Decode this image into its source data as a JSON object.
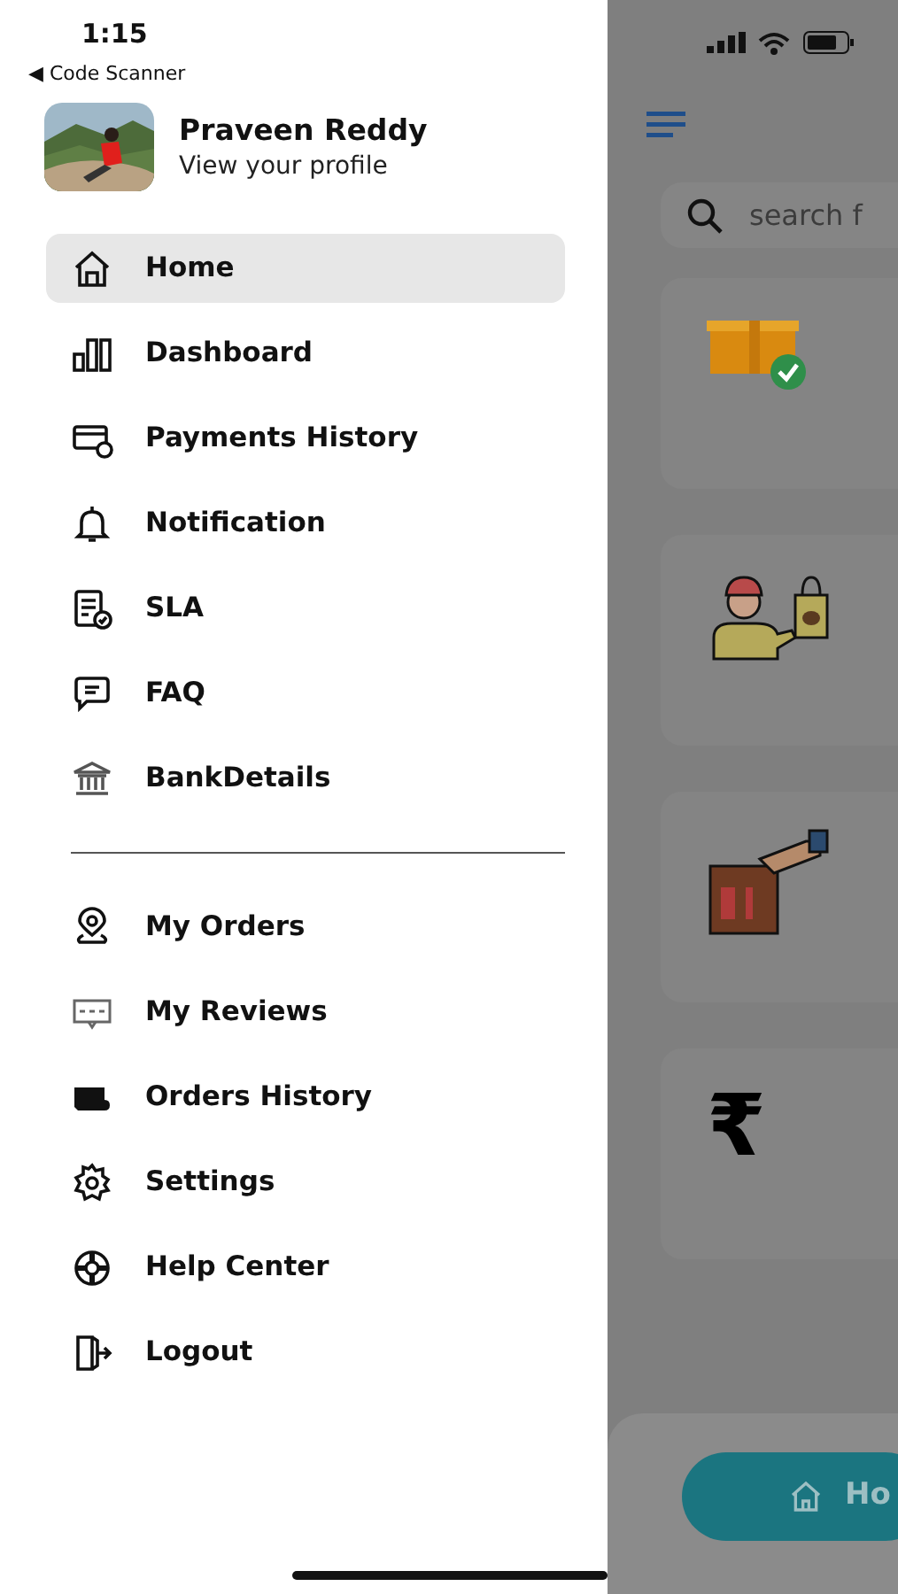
{
  "status_bar": {
    "time": "1:15",
    "back_label": "◀ Code Scanner"
  },
  "profile": {
    "name": "Praveen Reddy",
    "subtitle": "View your profile"
  },
  "menu_sections": [
    [
      {
        "label": "Home",
        "kind": "home",
        "selected": true
      },
      {
        "label": "Dashboard",
        "kind": "bars",
        "selected": false
      },
      {
        "label": "Payments History",
        "kind": "card",
        "selected": false
      },
      {
        "label": "Notification",
        "kind": "bell",
        "selected": false
      },
      {
        "label": "SLA",
        "kind": "doc",
        "selected": false
      },
      {
        "label": "FAQ",
        "kind": "faq",
        "selected": false
      },
      {
        "label": "BankDetails",
        "kind": "bank",
        "selected": false
      }
    ],
    [
      {
        "label": "My Orders",
        "kind": "pin",
        "selected": false
      },
      {
        "label": "My Reviews",
        "kind": "review",
        "selected": false
      },
      {
        "label": "Orders History",
        "kind": "ticket",
        "selected": false
      },
      {
        "label": "Settings",
        "kind": "gear",
        "selected": false
      },
      {
        "label": "Help Center",
        "kind": "lifebuoy",
        "selected": false
      },
      {
        "label": "Logout",
        "kind": "logout",
        "selected": false
      }
    ]
  ],
  "background_screen": {
    "search": {
      "placeholder": "search f"
    },
    "cards": [
      {
        "kind": "box"
      },
      {
        "kind": "courier"
      },
      {
        "kind": "bag"
      },
      {
        "kind": "symbol",
        "symbol": "₹"
      }
    ],
    "bottom_nav": {
      "label": "Ho"
    }
  }
}
